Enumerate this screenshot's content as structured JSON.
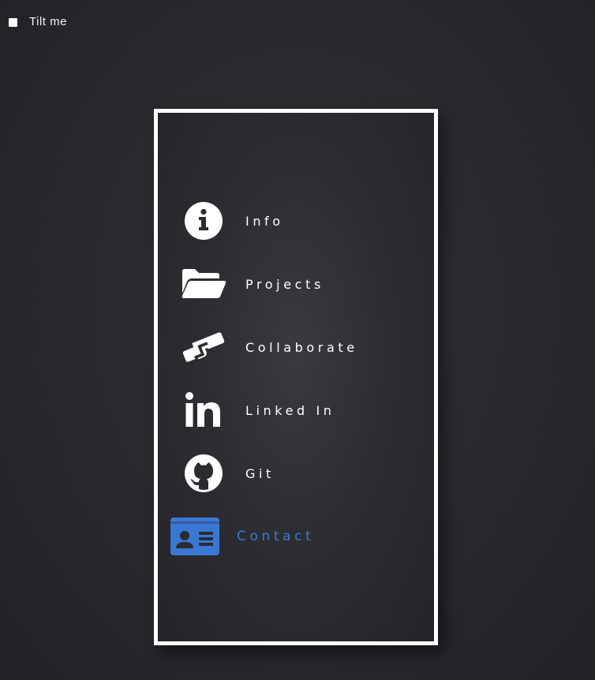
{
  "toggle": {
    "label": "Tilt me",
    "checked": false
  },
  "menu": {
    "accent_color": "#3a78d4",
    "items": [
      {
        "label": "Info",
        "icon": "info-circle-icon",
        "active": false
      },
      {
        "label": "Projects",
        "icon": "folder-open-icon",
        "active": false
      },
      {
        "label": "Collaborate",
        "icon": "handshake-icon",
        "active": false
      },
      {
        "label": "Linked In",
        "icon": "linkedin-icon",
        "active": false
      },
      {
        "label": "Git",
        "icon": "github-icon",
        "active": false
      },
      {
        "label": "Contact",
        "icon": "contact-card-icon",
        "active": true
      }
    ]
  }
}
